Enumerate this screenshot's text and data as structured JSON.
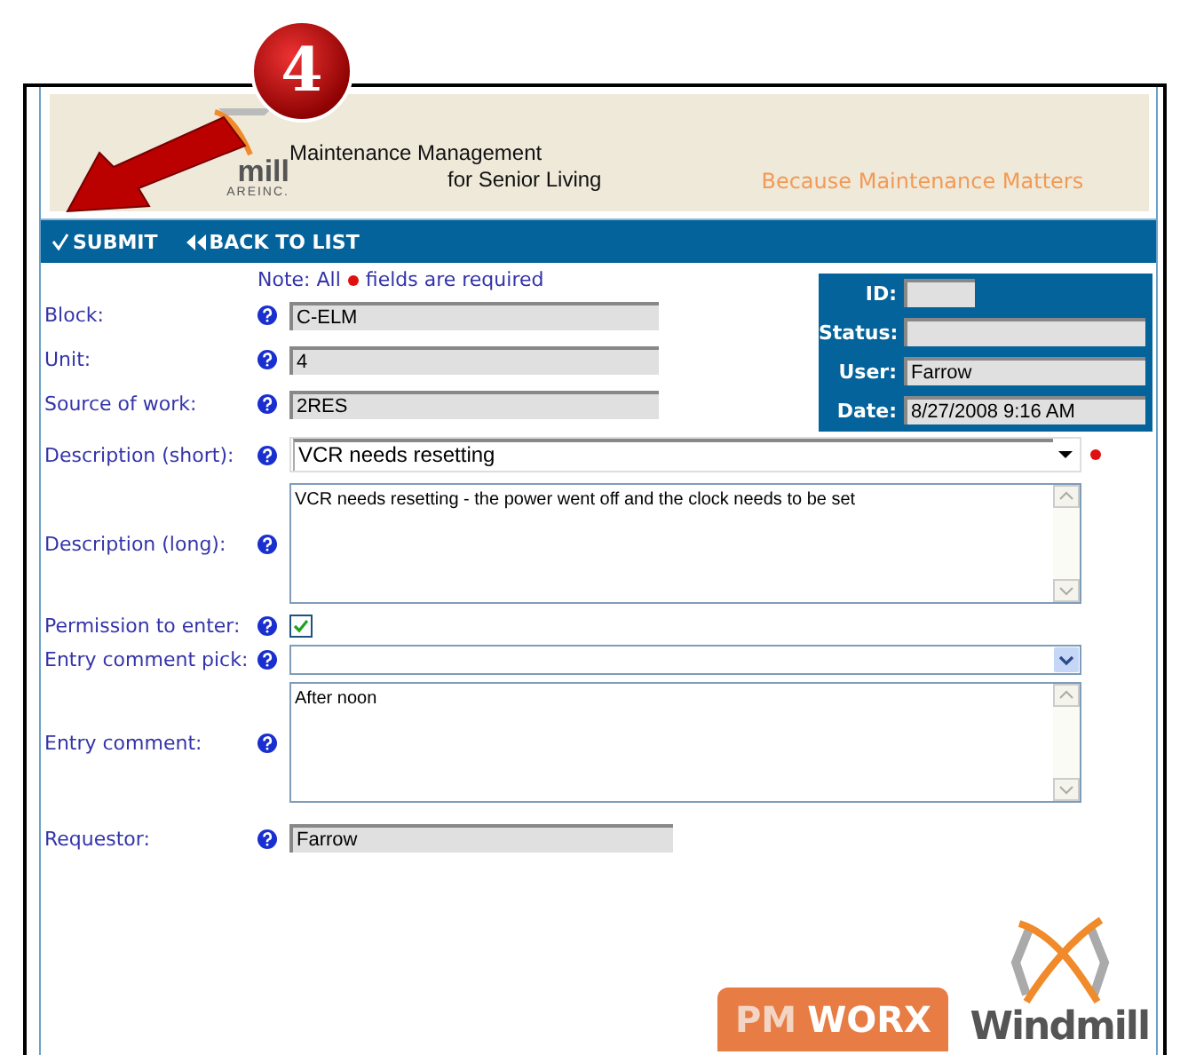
{
  "callout": {
    "number": "4"
  },
  "header": {
    "logo_text": "mill",
    "logo_subtext": "AREINC.",
    "title_line_1": "Maintenance Management",
    "title_line_2": "for Senior Living",
    "slogan": "Because Maintenance Matters"
  },
  "toolbar": [
    {
      "kind": "check",
      "label": "SUBMIT"
    },
    {
      "kind": "rewind",
      "label": "BACK TO LIST"
    }
  ],
  "note": {
    "before": "Note: All",
    "after": "fields are required"
  },
  "top_fields": [
    {
      "label": "Block:",
      "value": "C-ELM"
    },
    {
      "label": "Unit:",
      "value": "4"
    },
    {
      "label": "Source of work:",
      "value": "2RES"
    }
  ],
  "info_panel": [
    {
      "label": "ID:"
    },
    {
      "label": "Status:"
    },
    {
      "label": "User:",
      "value": "Farrow"
    },
    {
      "label": "Date:",
      "value": "8/27/2008 9:16 AM"
    }
  ],
  "fields": [
    {
      "kind": "combo",
      "label": "Description (short):",
      "value": "VCR needs resetting",
      "required": true
    },
    {
      "kind": "textarea",
      "label": "Description (long):",
      "value": "VCR needs resetting - the power went off and the clock needs to be set",
      "required": false
    },
    {
      "kind": "checkbox",
      "label": "Permission to enter:",
      "checked": true,
      "required": false
    },
    {
      "kind": "select",
      "label": "Entry comment pick:",
      "required": false
    },
    {
      "kind": "textarea",
      "label": "Entry comment:",
      "value": "After noon",
      "required": false
    },
    {
      "kind": "readonly",
      "label": "Requestor:",
      "value": "Farrow",
      "required": false
    }
  ],
  "footer": {
    "badge_part_1": "PM",
    "badge_part_2": "WORX",
    "logo_text": "Windmill"
  }
}
